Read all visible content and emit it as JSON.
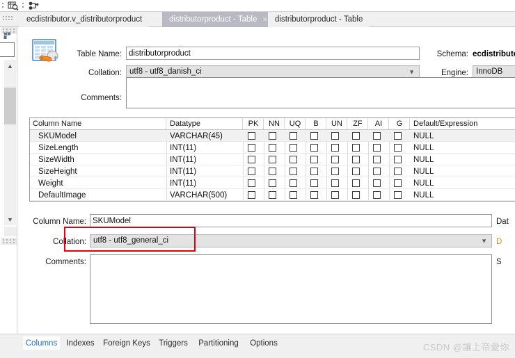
{
  "toolbar": {
    "icons": [
      {
        "name": "search-table-icon"
      },
      {
        "name": "route-flow-icon"
      }
    ]
  },
  "tabs": [
    {
      "label": "ecdistributor.v_distributorproduct",
      "selected": false,
      "closable": false
    },
    {
      "label": "distributorproduct - Table",
      "selected": true,
      "closable": true,
      "close_glyph": "×"
    },
    {
      "label": "distributorproduct - Table",
      "selected": false,
      "closable": false
    }
  ],
  "table_header": {
    "icon_name": "table-editor-icon",
    "table_name_label": "Table Name:",
    "table_name_value": "distributorproduct",
    "schema_label": "Schema:",
    "schema_value": "ecdistributor",
    "collation_label": "Collation:",
    "collation_value": "utf8 - utf8_danish_ci",
    "engine_label": "Engine:",
    "engine_value": "InnoDB",
    "comments_label": "Comments:",
    "comments_value": ""
  },
  "grid": {
    "columns": [
      "Column Name",
      "Datatype",
      "PK",
      "NN",
      "UQ",
      "B",
      "UN",
      "ZF",
      "AI",
      "G",
      "Default/Expression"
    ],
    "rows": [
      {
        "name": "SKUModel",
        "datatype": "VARCHAR(45)",
        "default": "NULL",
        "selected": true,
        "flags": {
          "PK": false,
          "NN": false,
          "UQ": false,
          "B": false,
          "UN": false,
          "ZF": false,
          "AI": false,
          "G": false
        }
      },
      {
        "name": "SizeLength",
        "datatype": "INT(11)",
        "default": "NULL",
        "selected": false,
        "flags": {
          "PK": false,
          "NN": false,
          "UQ": false,
          "B": false,
          "UN": false,
          "ZF": false,
          "AI": false,
          "G": false
        }
      },
      {
        "name": "SizeWidth",
        "datatype": "INT(11)",
        "default": "NULL",
        "selected": false,
        "flags": {
          "PK": false,
          "NN": false,
          "UQ": false,
          "B": false,
          "UN": false,
          "ZF": false,
          "AI": false,
          "G": false
        }
      },
      {
        "name": "SizeHeight",
        "datatype": "INT(11)",
        "default": "NULL",
        "selected": false,
        "flags": {
          "PK": false,
          "NN": false,
          "UQ": false,
          "B": false,
          "UN": false,
          "ZF": false,
          "AI": false,
          "G": false
        }
      },
      {
        "name": "Weight",
        "datatype": "INT(11)",
        "default": "NULL",
        "selected": false,
        "flags": {
          "PK": false,
          "NN": false,
          "UQ": false,
          "B": false,
          "UN": false,
          "ZF": false,
          "AI": false,
          "G": false
        }
      },
      {
        "name": "DefaultImage",
        "datatype": "VARCHAR(500)",
        "default": "NULL",
        "selected": false,
        "flags": {
          "PK": false,
          "NN": false,
          "UQ": false,
          "B": false,
          "UN": false,
          "ZF": false,
          "AI": false,
          "G": false
        }
      }
    ]
  },
  "detail": {
    "column_name_label": "Column Name:",
    "column_name_value": "SKUModel",
    "collation_label": "Collation:",
    "collation_value": "utf8 - utf8_general_ci",
    "comments_label": "Comments:",
    "comments_value": "",
    "datatype_label_clipped": "Dat",
    "default_label_clipped": "D",
    "storage_label_clipped": "S",
    "annotation_color": "#e3000f"
  },
  "bottom_tabs": [
    {
      "label": "Columns",
      "active": true
    },
    {
      "label": "Indexes",
      "active": false
    },
    {
      "label": "Foreign Keys",
      "active": false
    },
    {
      "label": "Triggers",
      "active": false
    },
    {
      "label": "Partitioning",
      "active": false
    },
    {
      "label": "Options",
      "active": false
    }
  ],
  "watermark": "CSDN @讓上帝愛你"
}
